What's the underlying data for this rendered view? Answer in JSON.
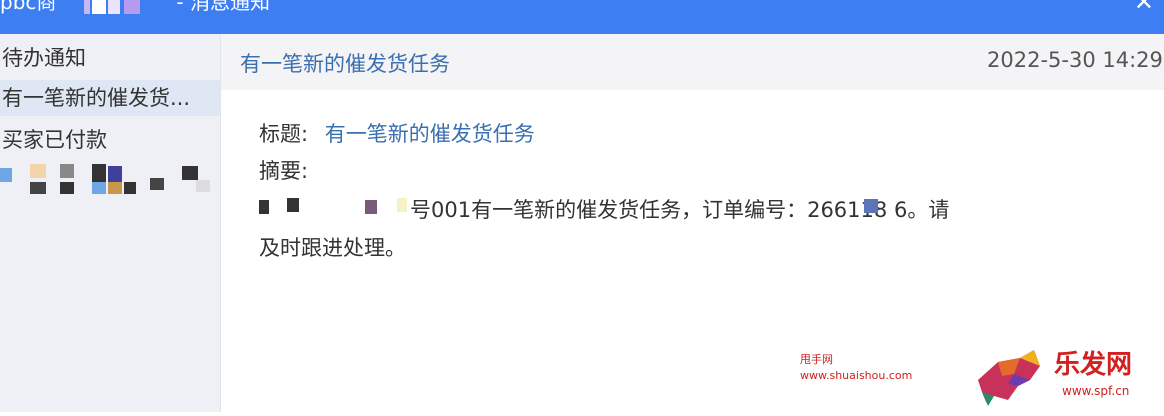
{
  "window": {
    "title": "pbc商",
    "title_suffix": "- 消息通知",
    "close_icon": "close-icon",
    "accent_color": "#3d7ff2"
  },
  "sidebar": {
    "items": [
      {
        "label": "待办通知"
      },
      {
        "label": "有一笔新的催发货..."
      },
      {
        "label": "买家已付款"
      }
    ]
  },
  "message": {
    "subject": "有一笔新的催发货任务",
    "time": "2022-5-30 14:29",
    "title_label": "标题:",
    "title_value": "有一笔新的催发货任务",
    "summary_label": "摘要:",
    "body_part1": "号001有一笔新的催发货任务，订单编号：266118",
    "body_part2": "6。请",
    "body_line2": "及时跟进处理。"
  },
  "watermark": {
    "line1": "甩手网",
    "line2": "www.shuaishou.com",
    "logo_text": "乐发网",
    "logo_url": "www.spf.cn"
  }
}
